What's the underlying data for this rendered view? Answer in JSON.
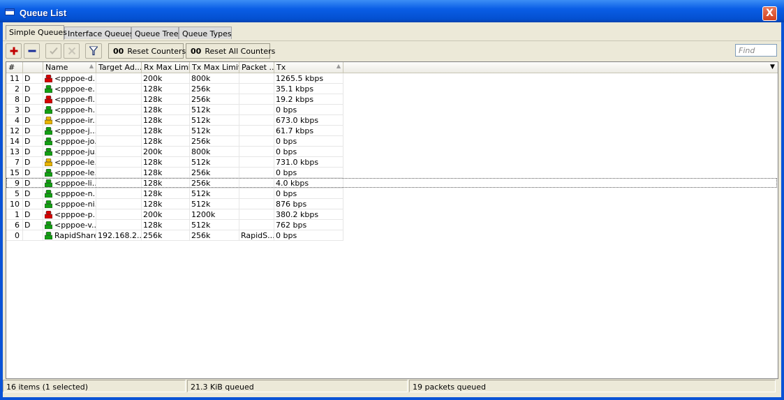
{
  "window": {
    "title": "Queue List",
    "close_label": "X"
  },
  "tabs": [
    {
      "label": "Simple Queues",
      "active": true
    },
    {
      "label": "Interface Queues",
      "active": false
    },
    {
      "label": "Queue Tree",
      "active": false
    },
    {
      "label": "Queue Types",
      "active": false
    }
  ],
  "toolbar": {
    "add_icon": "plus-icon",
    "remove_icon": "minus-icon",
    "enable_icon": "check-icon",
    "disable_icon": "x-icon",
    "filter_icon": "filter-icon",
    "reset_counters": {
      "prefix": "00",
      "label": "Reset Counters"
    },
    "reset_all_counters": {
      "prefix": "00",
      "label": "Reset All Counters"
    },
    "find_placeholder": "Find"
  },
  "columns": [
    "#",
    "",
    "Name",
    "Target Ad...",
    "Rx Max Limit",
    "Tx Max Limit",
    "Packet ...",
    "Tx"
  ],
  "rows": [
    {
      "num": "11",
      "flag": "D",
      "icon_color": "#d80000",
      "name": "<pppoe-d...",
      "target": "",
      "rx": "200k",
      "tx_max": "800k",
      "packet": "",
      "tx": "1265.5 kbps",
      "selected": false
    },
    {
      "num": "2",
      "flag": "D",
      "icon_color": "#12a012",
      "name": "<pppoe-e...",
      "target": "",
      "rx": "128k",
      "tx_max": "256k",
      "packet": "",
      "tx": "35.1 kbps",
      "selected": false
    },
    {
      "num": "8",
      "flag": "D",
      "icon_color": "#d80000",
      "name": "<pppoe-fl...",
      "target": "",
      "rx": "128k",
      "tx_max": "256k",
      "packet": "",
      "tx": "19.2 kbps",
      "selected": false
    },
    {
      "num": "3",
      "flag": "D",
      "icon_color": "#12a012",
      "name": "<pppoe-h...",
      "target": "",
      "rx": "128k",
      "tx_max": "512k",
      "packet": "",
      "tx": "0 bps",
      "selected": false
    },
    {
      "num": "4",
      "flag": "D",
      "icon_color": "#e8b400",
      "name": "<pppoe-ir...",
      "target": "",
      "rx": "128k",
      "tx_max": "512k",
      "packet": "",
      "tx": "673.0 kbps",
      "selected": false
    },
    {
      "num": "12",
      "flag": "D",
      "icon_color": "#12a012",
      "name": "<pppoe-j...",
      "target": "",
      "rx": "128k",
      "tx_max": "512k",
      "packet": "",
      "tx": "61.7 kbps",
      "selected": false
    },
    {
      "num": "14",
      "flag": "D",
      "icon_color": "#12a012",
      "name": "<pppoe-jo...",
      "target": "",
      "rx": "128k",
      "tx_max": "256k",
      "packet": "",
      "tx": "0 bps",
      "selected": false
    },
    {
      "num": "13",
      "flag": "D",
      "icon_color": "#12a012",
      "name": "<pppoe-ju...",
      "target": "",
      "rx": "200k",
      "tx_max": "800k",
      "packet": "",
      "tx": "0 bps",
      "selected": false
    },
    {
      "num": "7",
      "flag": "D",
      "icon_color": "#e8b400",
      "name": "<pppoe-le...",
      "target": "",
      "rx": "128k",
      "tx_max": "512k",
      "packet": "",
      "tx": "731.0 kbps",
      "selected": false
    },
    {
      "num": "15",
      "flag": "D",
      "icon_color": "#12a012",
      "name": "<pppoe-le...",
      "target": "",
      "rx": "128k",
      "tx_max": "256k",
      "packet": "",
      "tx": "0 bps",
      "selected": false
    },
    {
      "num": "9",
      "flag": "D",
      "icon_color": "#12a012",
      "name": "<pppoe-li...",
      "target": "",
      "rx": "128k",
      "tx_max": "256k",
      "packet": "",
      "tx": "4.0 kbps",
      "selected": true
    },
    {
      "num": "5",
      "flag": "D",
      "icon_color": "#12a012",
      "name": "<pppoe-n...",
      "target": "",
      "rx": "128k",
      "tx_max": "512k",
      "packet": "",
      "tx": "0 bps",
      "selected": false
    },
    {
      "num": "10",
      "flag": "D",
      "icon_color": "#12a012",
      "name": "<pppoe-ni...",
      "target": "",
      "rx": "128k",
      "tx_max": "512k",
      "packet": "",
      "tx": "876 bps",
      "selected": false
    },
    {
      "num": "1",
      "flag": "D",
      "icon_color": "#d80000",
      "name": "<pppoe-p...",
      "target": "",
      "rx": "200k",
      "tx_max": "1200k",
      "packet": "",
      "tx": "380.2 kbps",
      "selected": false
    },
    {
      "num": "6",
      "flag": "D",
      "icon_color": "#12a012",
      "name": "<pppoe-v...",
      "target": "",
      "rx": "128k",
      "tx_max": "512k",
      "packet": "",
      "tx": "762 bps",
      "selected": false
    },
    {
      "num": "0",
      "flag": "",
      "icon_color": "#12a012",
      "name": "RapidShare",
      "target": "192.168.2....",
      "rx": "256k",
      "tx_max": "256k",
      "packet": "RapidS...",
      "tx": "0 bps",
      "selected": false
    }
  ],
  "statusbar": {
    "items": "16 items (1 selected)",
    "queued": "21.3 KiB queued",
    "packets": "19 packets queued"
  }
}
